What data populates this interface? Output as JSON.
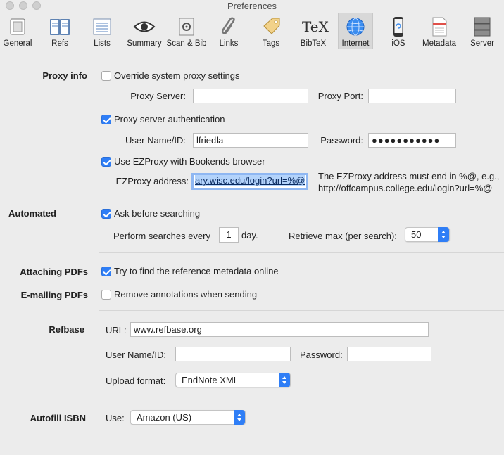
{
  "window": {
    "title": "Preferences"
  },
  "toolbar": {
    "items": [
      {
        "label": "General",
        "icon": "general-icon"
      },
      {
        "label": "Refs",
        "icon": "refs-icon"
      },
      {
        "label": "Lists",
        "icon": "lists-icon"
      },
      {
        "label": "Summary",
        "icon": "eye-icon"
      },
      {
        "label": "Scan & Bib",
        "icon": "scan-icon"
      },
      {
        "label": "Links",
        "icon": "paperclip-icon"
      },
      {
        "label": "Tags",
        "icon": "tag-icon"
      },
      {
        "label": "BibTeX",
        "icon": "tex-icon"
      },
      {
        "label": "Internet",
        "icon": "globe-icon"
      },
      {
        "label": "iOS",
        "icon": "phone-icon"
      },
      {
        "label": "Metadata",
        "icon": "document-icon"
      },
      {
        "label": "Server",
        "icon": "server-icon"
      }
    ],
    "selected": "Internet",
    "tex_glyph": "TeX"
  },
  "proxy": {
    "section": "Proxy info",
    "override_label": "Override system proxy settings",
    "override_checked": false,
    "server_label": "Proxy Server:",
    "server_value": "",
    "port_label": "Proxy Port:",
    "port_value": "",
    "auth_label": "Proxy server authentication",
    "auth_checked": true,
    "user_label": "User Name/ID:",
    "user_value": "lfriedla",
    "password_label": "Password:",
    "password_value": "●●●●●●●●●●●",
    "ezproxy_label": "Use EZProxy with Bookends browser",
    "ezproxy_checked": true,
    "ezaddr_label": "EZProxy address:",
    "ezaddr_value": "ary.wisc.edu/login?url=%@",
    "ez_note_line1": "The EZProxy address must end in %@, e.g.,",
    "ez_note_line2": "http://offcampus.college.edu/login?url=%@"
  },
  "automated": {
    "section": "Automated",
    "ask_label": "Ask before searching",
    "ask_checked": true,
    "perform_label": "Perform searches every",
    "days_value": "1",
    "day_label": "day.",
    "retrieve_label": "Retrieve max (per search):",
    "retrieve_value": "50"
  },
  "attaching": {
    "section": "Attaching PDFs",
    "label": "Try to find the reference metadata online",
    "checked": true
  },
  "emailing": {
    "section": "E-mailing PDFs",
    "label": "Remove annotations when sending",
    "checked": false
  },
  "refbase": {
    "section": "Refbase",
    "url_label": "URL:",
    "url_value": "www.refbase.org",
    "user_label": "User Name/ID:",
    "user_value": "",
    "password_label": "Password:",
    "password_value": "",
    "upload_label": "Upload format:",
    "upload_value": "EndNote XML"
  },
  "autofill": {
    "section": "Autofill ISBN",
    "use_label": "Use:",
    "use_value": "Amazon (US)"
  },
  "colors": {
    "accent": "#2f7ef6",
    "selection": "#b3d3fb",
    "focus_ring": "#8fb7f2"
  }
}
